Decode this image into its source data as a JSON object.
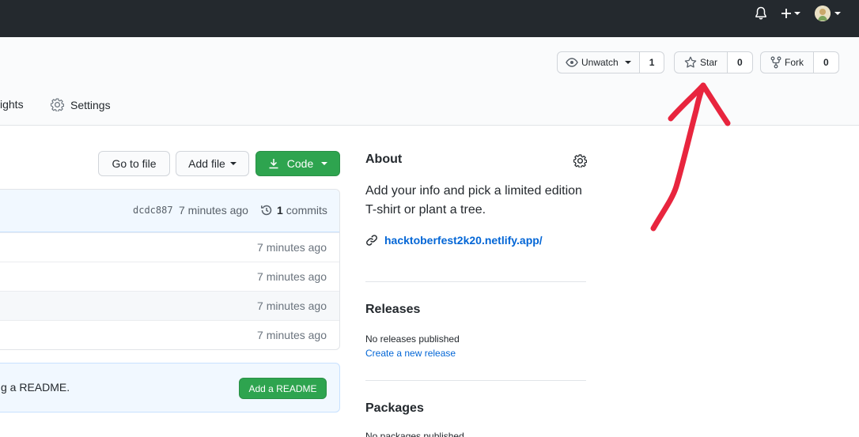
{
  "colors": {
    "topbar": "#24292e",
    "green": "#2ea44f",
    "link": "#0366d6",
    "annotation": "#e8253e"
  },
  "topbar": {
    "icons": [
      "bell-icon",
      "plus-icon",
      "avatar"
    ]
  },
  "repo_actions": {
    "watch": {
      "label": "Unwatch",
      "count": "1"
    },
    "star": {
      "label": "Star",
      "count": "0"
    },
    "fork": {
      "label": "Fork",
      "count": "0"
    }
  },
  "tabs": {
    "insights_partial": "ights",
    "settings": "Settings"
  },
  "file_buttons": {
    "go_to_file": "Go to file",
    "add_file": "Add file",
    "code": "Code"
  },
  "commit": {
    "hash": "dcdc887",
    "time": "7 minutes ago",
    "count": "1",
    "label": "commits"
  },
  "files": [
    {
      "time": "7 minutes ago"
    },
    {
      "time": "7 minutes ago"
    },
    {
      "time": "7 minutes ago"
    },
    {
      "time": "7 minutes ago"
    }
  ],
  "readme": {
    "text_partial": "g a README.",
    "button": "Add a README"
  },
  "about": {
    "title": "About",
    "description": "Add your info and pick a limited edition T-shirt or plant a tree.",
    "website": "hacktoberfest2k20.netlify.app/"
  },
  "releases": {
    "title": "Releases",
    "none": "No releases published",
    "create": "Create a new release"
  },
  "packages": {
    "title": "Packages",
    "none": "No packages published"
  }
}
